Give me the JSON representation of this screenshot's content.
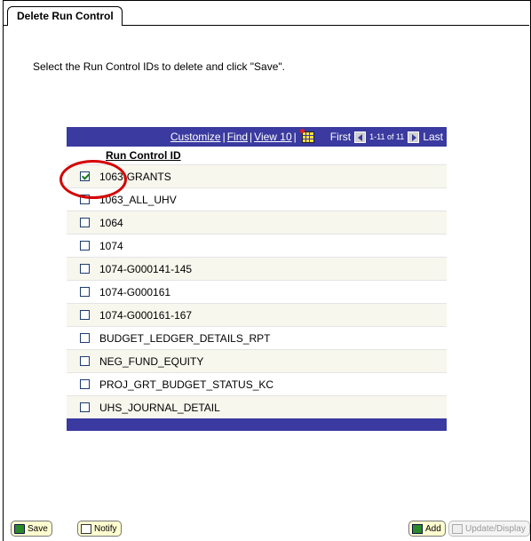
{
  "tab": {
    "label": "Delete Run Control"
  },
  "instructions": "Select the Run Control IDs to delete and click \"Save\".",
  "grid": {
    "header": {
      "customize": "Customize",
      "find": "Find",
      "view": "View 10",
      "first": "First",
      "range": "1-11 of 11",
      "last": "Last"
    },
    "column_header": "Run Control ID",
    "rows": [
      {
        "id": "1063-GRANTS",
        "checked": true
      },
      {
        "id": "1063_ALL_UHV",
        "checked": false
      },
      {
        "id": "1064",
        "checked": false
      },
      {
        "id": "1074",
        "checked": false
      },
      {
        "id": "1074-G000141-145",
        "checked": false
      },
      {
        "id": "1074-G000161",
        "checked": false
      },
      {
        "id": "1074-G000161-167",
        "checked": false
      },
      {
        "id": "BUDGET_LEDGER_DETAILS_RPT",
        "checked": false
      },
      {
        "id": "NEG_FUND_EQUITY",
        "checked": false
      },
      {
        "id": "PROJ_GRT_BUDGET_STATUS_KC",
        "checked": false
      },
      {
        "id": "UHS_JOURNAL_DETAIL",
        "checked": false
      }
    ]
  },
  "buttons": {
    "save": "Save",
    "notify": "Notify",
    "add": "Add",
    "update_display": "Update/Display"
  },
  "colors": {
    "grid_header": "#3a3aa0",
    "highlight_circle": "#d40000"
  }
}
